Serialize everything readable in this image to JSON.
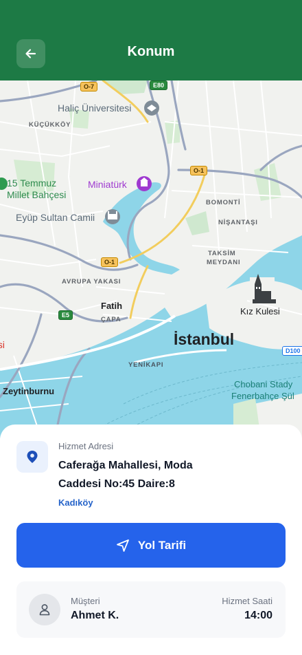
{
  "header": {
    "title": "Konum",
    "back_icon": "arrow-left-icon",
    "background": "#1d7a45"
  },
  "map": {
    "labels": {
      "halic": "Haliç Üniversitesi",
      "kucukkoy": "KÜÇÜKKÖY",
      "temmuz": "15 Temmuz",
      "millet": "Millet Bahçesi",
      "miniaturk": "Miniatürk",
      "eyup": "Eyüp Sultan Camii",
      "bomonti": "BOMONTİ",
      "nisantasi": "NİŞANTAŞI",
      "taksim": "TAKSİM",
      "meydani": "MEYDANI",
      "avrupa": "AVRUPA YAKASI",
      "fatih": "Fatih",
      "capa": "ÇAPA",
      "kiz_kulesi": "Kız Kulesi",
      "istanbul": "İstanbul",
      "yenikapi": "YENİKAPI",
      "zeytinburnu": "Zeytinburnu",
      "chobani": "Chobani Stady",
      "fenerbahce": "Fenerbahçe Şül",
      "edge_red": "esi"
    },
    "shields": {
      "o7": "O-7",
      "e80": "E80",
      "o1_a": "O-1",
      "o1_b": "O-1",
      "e5": "E5",
      "d100": "D100"
    }
  },
  "address": {
    "caption": "Hizmet Adresi",
    "line1": "Caferağa Mahallesi, Moda",
    "line2": "Caddesi No:45 Daire:8",
    "district": "Kadıköy",
    "icon": "map-pin-icon"
  },
  "directions": {
    "label": "Yol Tarifi",
    "icon": "navigation-arrow-icon",
    "color": "#2563eb"
  },
  "customer": {
    "caption": "Müşteri",
    "name": "Ahmet K.",
    "avatar_icon": "user-icon",
    "time_caption": "Hizmet Saati",
    "time": "14:00"
  }
}
